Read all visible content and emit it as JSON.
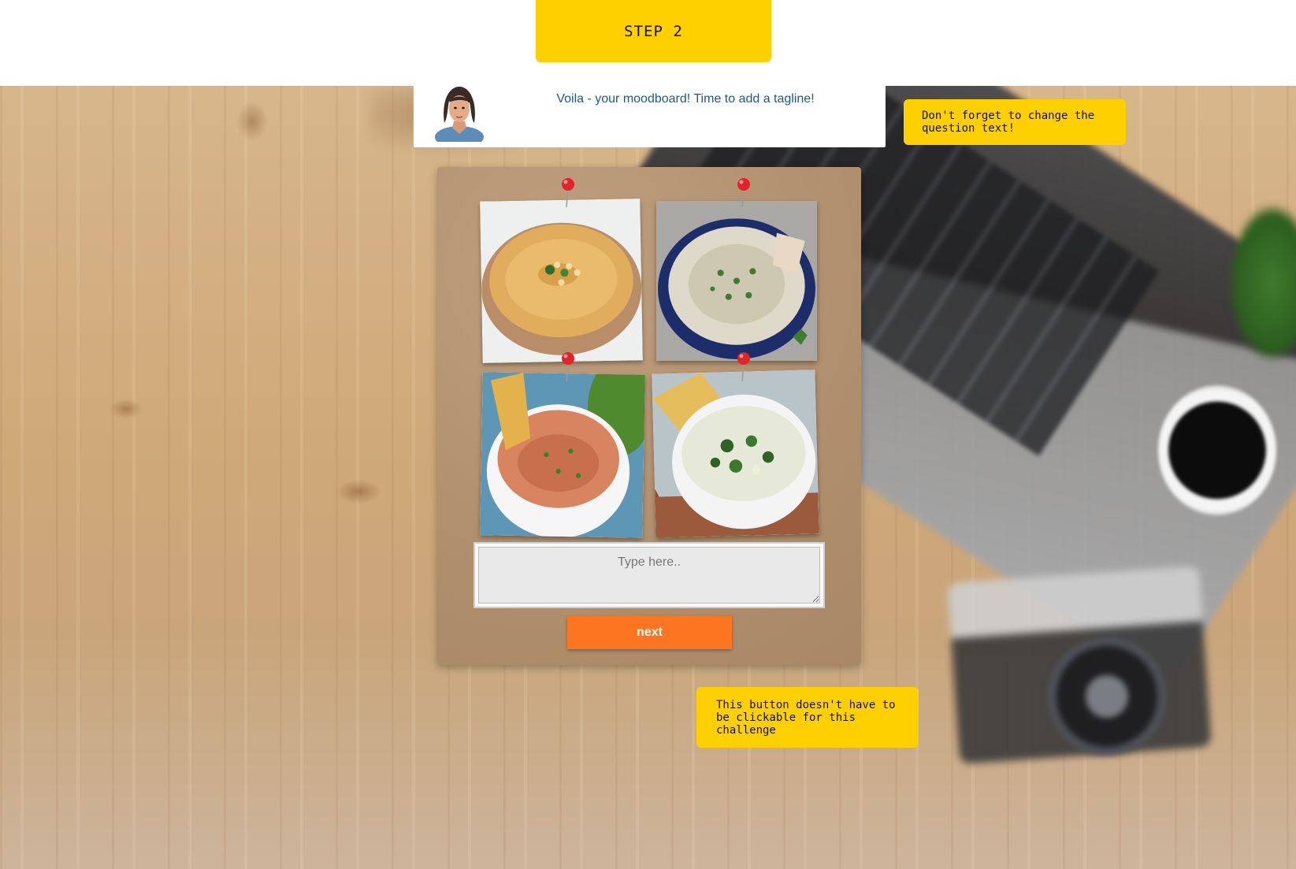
{
  "step": {
    "label": "STEP 2"
  },
  "chat": {
    "message": "Voila - your moodboard! Time to add a tagline!"
  },
  "notes": {
    "question_text": "Don't forget to change the question text!",
    "button_hint": "This button doesn't have to be clickable for this challenge"
  },
  "moodboard": {
    "photos": [
      {
        "icon": "hummus-photo-icon"
      },
      {
        "icon": "baba-ganoush-photo-icon"
      },
      {
        "icon": "chili-cheese-dip-photo-icon"
      },
      {
        "icon": "spinach-artichoke-dip-photo-icon"
      }
    ]
  },
  "tagline": {
    "placeholder": "Type here..",
    "value": ""
  },
  "actions": {
    "next_label": "next"
  },
  "colors": {
    "accent": "#ffd000",
    "button": "#fd7521",
    "chat_text": "#1a5a8c",
    "pin": "#e0242b"
  }
}
